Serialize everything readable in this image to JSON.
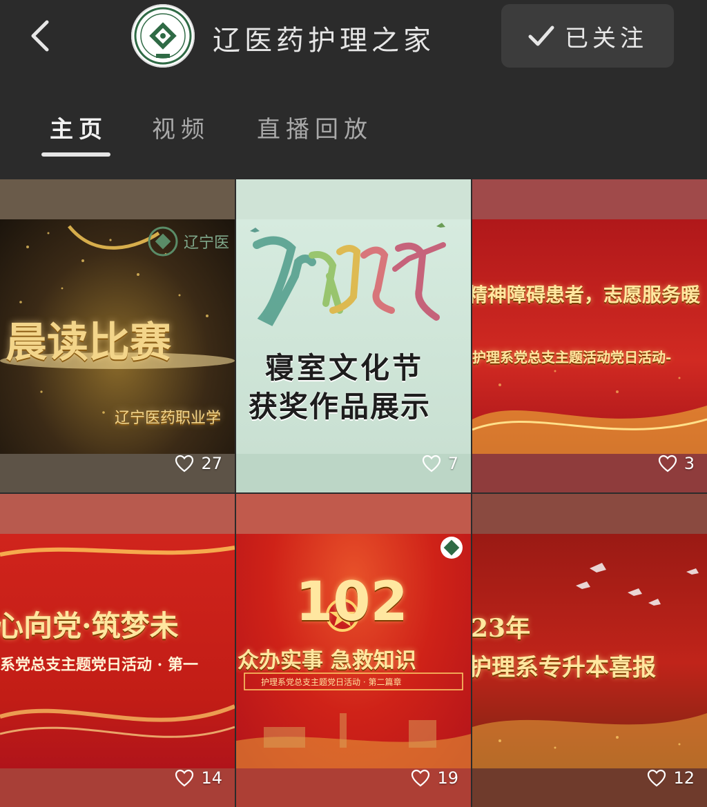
{
  "header": {
    "back_icon": "chevron-left-icon",
    "account_name": "辽医药护理之家",
    "follow_label": "已关注",
    "follow_icon": "check-icon"
  },
  "tabs": [
    {
      "label": "主页",
      "active": true
    },
    {
      "label": "视频",
      "active": false
    },
    {
      "label": "直播回放",
      "active": false
    }
  ],
  "videos": [
    {
      "poster_lines": [
        "晨读比赛"
      ],
      "subtitle": "辽宁医药职业学",
      "logo_text": "辽宁医",
      "likes": "27"
    },
    {
      "poster_lines": [
        "寝室文化节",
        "获奖作品展示"
      ],
      "likes": "7"
    },
    {
      "poster_lines": [
        "精神障碍患者，志愿服务暖",
        "护理系党总支主题活动党日活动-"
      ],
      "likes": "3"
    },
    {
      "poster_lines": [
        "心向党·筑梦未",
        "系党总支主题党日活动 · 第一"
      ],
      "likes": "14"
    },
    {
      "poster_lines": [
        "102",
        "众办实事 急救知识",
        "护理系党总支主题党日活动 · 第二篇章"
      ],
      "likes": "19"
    },
    {
      "poster_lines": [
        "23年",
        "护理系专升本喜报"
      ],
      "likes": "12"
    }
  ],
  "colors": {
    "background": "#2b2b2b",
    "follow_button": "#3c3c3c",
    "poster_red": "#c81e1e",
    "poster_mint": "#d7ebe0"
  }
}
